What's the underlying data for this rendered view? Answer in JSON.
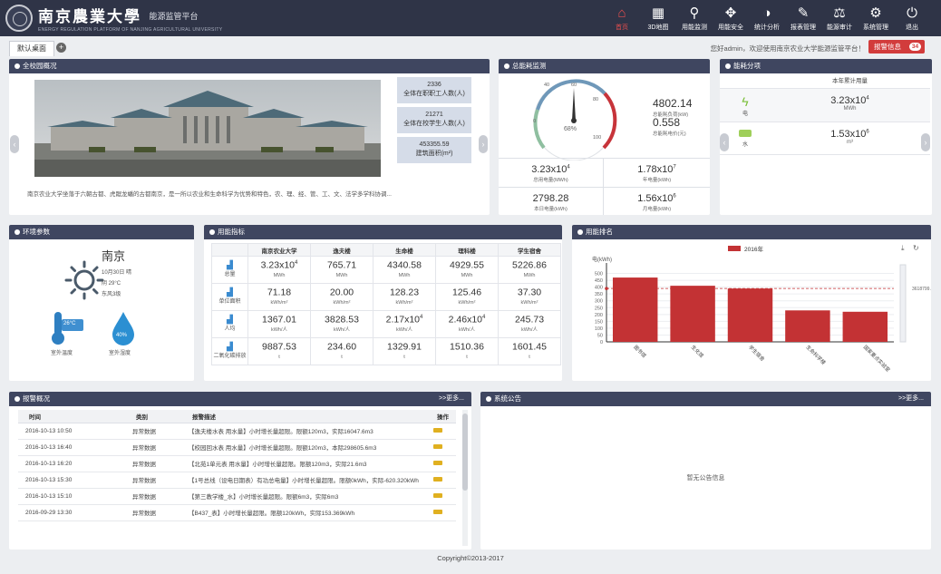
{
  "header": {
    "logo_cn": "南京農業大學",
    "subtitle": "能源监管平台",
    "logo_en": "ENERGY REGULATION PLATFORM OF NANJING AGRICULTURAL UNIVERSITY",
    "nav": [
      {
        "label": "首页",
        "icon": "home-icon",
        "glyph": "⌂"
      },
      {
        "label": "3D地图",
        "icon": "map-icon",
        "glyph": "▦"
      },
      {
        "label": "用能监测",
        "icon": "search-icon",
        "glyph": "⚲"
      },
      {
        "label": "用能安全",
        "icon": "puzzle-icon",
        "glyph": "✥"
      },
      {
        "label": "统计分析",
        "icon": "pie-chart-icon",
        "glyph": "◑"
      },
      {
        "label": "报表管理",
        "icon": "pencil-icon",
        "glyph": "✎"
      },
      {
        "label": "能源审计",
        "icon": "scale-icon",
        "glyph": "⚖"
      },
      {
        "label": "系统管理",
        "icon": "gear-icon",
        "glyph": "⚙"
      },
      {
        "label": "退出",
        "icon": "power-icon",
        "glyph": "⏻"
      }
    ]
  },
  "tabs": {
    "home": "默认桌面",
    "add": "+"
  },
  "welcome": "您好admin，欢迎使用南京农业大学能源监管平台！",
  "message_button": {
    "label": "报警信息",
    "count": "34"
  },
  "campus": {
    "title": "全校园概况",
    "stats": [
      {
        "value": "2336",
        "label": "全体在职职工人数(人)"
      },
      {
        "value": "21271",
        "label": "全体在校学生人数(人)"
      },
      {
        "value": "453355.59",
        "label": "建筑面积(m²)"
      }
    ],
    "description": "南京农业大学坐落于六朝古都、虎踞龙蟠的古都南京，是一所以农业和生命科学为优势和特色，农、理、经、管、工、文、法学多学科协调..."
  },
  "meter": {
    "title": "总能耗监测",
    "gauge_percent": "68%",
    "gauge_ticks": [
      "0",
      "40",
      "60",
      "80",
      "100"
    ],
    "today_value": "4802.14",
    "today_label": "总能耗负荷(kW)",
    "cost_value": "0.558",
    "cost_label": "总能耗电价(元)",
    "cells": [
      {
        "value": "3.23x10",
        "sup": "4",
        "label": "总用电量(MWh)"
      },
      {
        "value": "1.78x10",
        "sup": "7",
        "label": "年电量(kWh)"
      },
      {
        "value": "2798.28",
        "sup": "",
        "label": "本日电量(kWh)"
      },
      {
        "value": "1.56x10",
        "sup": "6",
        "label": "月电量(kWh)"
      }
    ]
  },
  "energy": {
    "title": "能耗分项",
    "header": "本年累计用量",
    "rows": [
      {
        "icon": "lightning-icon",
        "name": "电",
        "value": "3.23x10",
        "sup": "4",
        "unit": "MWh"
      },
      {
        "icon": "water-icon",
        "name": "水",
        "value": "1.53x10",
        "sup": "6",
        "unit": "m³"
      }
    ]
  },
  "env": {
    "title": "环境参数",
    "city": "南京",
    "lines": [
      "10月30日 晴",
      "阴 29°C",
      "东风3级"
    ],
    "temp_label": "室外温度",
    "temp_value": "26°C",
    "humidity_label": "室外湿度",
    "humidity_value": "40%"
  },
  "usage": {
    "title": "用能指标",
    "columns": [
      "南京农业大学",
      "逸夫楼",
      "生命楼",
      "理科楼",
      "学生宿舍"
    ],
    "rows": [
      {
        "label": "总量",
        "cells": [
          {
            "v": "3.23x10",
            "sup": "4",
            "u": "MWh"
          },
          {
            "v": "765.71",
            "sup": "",
            "u": "MWh"
          },
          {
            "v": "4340.58",
            "sup": "",
            "u": "MWh"
          },
          {
            "v": "4929.55",
            "sup": "",
            "u": "MWh"
          },
          {
            "v": "5226.86",
            "sup": "",
            "u": "MWh"
          }
        ]
      },
      {
        "label": "单位面积",
        "cells": [
          {
            "v": "71.18",
            "sup": "",
            "u": "kWh/m²"
          },
          {
            "v": "20.00",
            "sup": "",
            "u": "kWh/m²"
          },
          {
            "v": "128.23",
            "sup": "",
            "u": "kWh/m²"
          },
          {
            "v": "125.46",
            "sup": "",
            "u": "kWh/m²"
          },
          {
            "v": "37.30",
            "sup": "",
            "u": "kWh/m²"
          }
        ]
      },
      {
        "label": "人均",
        "cells": [
          {
            "v": "1367.01",
            "sup": "",
            "u": "kWh/人"
          },
          {
            "v": "3828.53",
            "sup": "",
            "u": "kWh/人"
          },
          {
            "v": "2.17x10",
            "sup": "4",
            "u": "kWh/人"
          },
          {
            "v": "2.46x10",
            "sup": "4",
            "u": "kWh/人"
          },
          {
            "v": "245.73",
            "sup": "",
            "u": "kWh/人"
          }
        ]
      },
      {
        "label": "二氧化碳排放",
        "cells": [
          {
            "v": "9887.53",
            "sup": "",
            "u": "t"
          },
          {
            "v": "234.60",
            "sup": "",
            "u": "t"
          },
          {
            "v": "1329.91",
            "sup": "",
            "u": "t"
          },
          {
            "v": "1510.36",
            "sup": "",
            "u": "t"
          },
          {
            "v": "1601.45",
            "sup": "",
            "u": "t"
          }
        ]
      }
    ]
  },
  "ranking": {
    "title": "用能排名"
  },
  "chart_data": {
    "type": "bar",
    "ylabel": "电(kWh)",
    "legend": "2016年",
    "categories": [
      "图书馆",
      "生化馆",
      "学生宿舍",
      "生命科学楼",
      "国家重点实验室"
    ],
    "values": [
      470,
      410,
      390,
      230,
      220
    ],
    "ylim": [
      0,
      550
    ],
    "yticks": [
      "0",
      "50",
      "100",
      "150",
      "200",
      "250",
      "300",
      "350",
      "400",
      "450",
      "500"
    ],
    "markline": "3618799.22",
    "color": "#c33234"
  },
  "alarm": {
    "title": "报警概况",
    "more": ">>更多...",
    "columns": [
      "时间",
      "类别",
      "报警描述",
      "操作"
    ],
    "rows": [
      {
        "time": "2016-10-13 10:50",
        "type": "异常数据",
        "desc": "【逸夫楼水表 用水量】小时增长量超限。限额120m3，实际16047.6m3"
      },
      {
        "time": "2016-10-13 16:40",
        "type": "异常数据",
        "desc": "【校园回水表 用水量】小时增长量超限。限额120m3，本际298605.6m3"
      },
      {
        "time": "2016-10-13 16:20",
        "type": "异常数据",
        "desc": "【北苑1单元表 用水量】小时增长量超限。限额120m3，实际21.6m3"
      },
      {
        "time": "2016-10-13 15:30",
        "type": "异常数据",
        "desc": "【1号总线（设电日期表）有功总电量】小时增长量超限。限额0kWh，实际-620.320kWh"
      },
      {
        "time": "2016-10-13 15:10",
        "type": "异常数据",
        "desc": "【第三教学楼_水】小时增长量超限。限额6m3，实际6m3"
      },
      {
        "time": "2016-09-29 13:30",
        "type": "异常数据",
        "desc": "【B437_表】小时增长量超限。限额120kWh，实际153.369kWh"
      }
    ]
  },
  "notice": {
    "title": "系统公告",
    "more": ">>更多...",
    "empty": "暂无公告信息"
  },
  "footer": "Copyright©2013-2017"
}
